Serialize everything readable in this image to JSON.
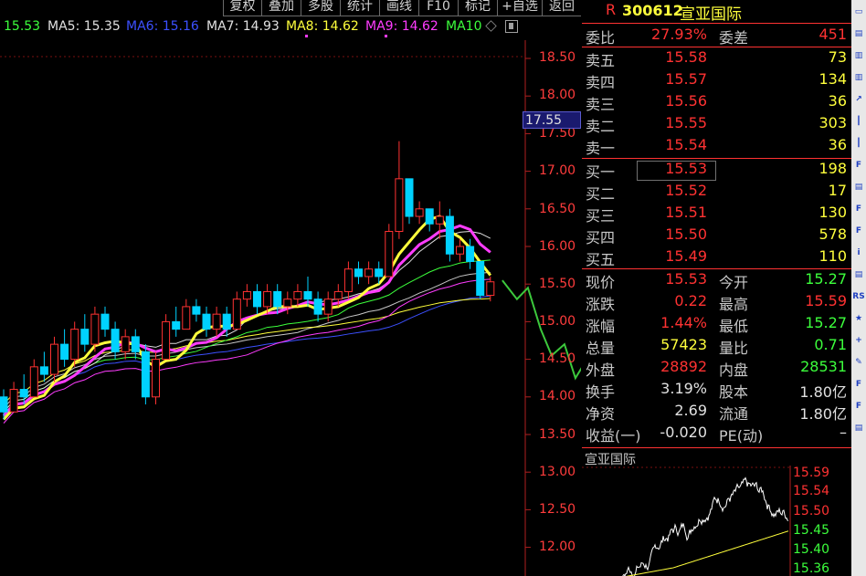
{
  "toolbar": {
    "items": [
      "复权",
      "叠加",
      "多股",
      "统计",
      "画线",
      "F10",
      "标记",
      "+自选",
      "返回"
    ]
  },
  "ma_legend": {
    "price": "15.53",
    "items": [
      {
        "label": "MA5: 15.35",
        "color": "#e0e0e0"
      },
      {
        "label": "MA6: 15.16",
        "color": "#3c50ff"
      },
      {
        "label": "MA7: 14.93",
        "color": "#e0e0e0"
      },
      {
        "label": "MA8: 14.62",
        "color": "#ffff3c"
      },
      {
        "label": "MA9: 14.62",
        "color": "#ff3cff"
      },
      {
        "label": "MA10",
        "color": "#3cff3c"
      }
    ]
  },
  "chart": {
    "axis_labels": [
      "18.50",
      "18.00",
      "17.50",
      "17.00",
      "16.50",
      "16.00",
      "15.50",
      "15.00",
      "14.50",
      "14.00",
      "13.50",
      "13.00",
      "12.50",
      "12.00"
    ],
    "crosshair_value": "17.55",
    "candles": [
      [
        14.0,
        14.1,
        13.7,
        13.8
      ],
      [
        13.8,
        14.2,
        13.8,
        14.1
      ],
      [
        14.1,
        14.3,
        13.9,
        14.0
      ],
      [
        14.0,
        14.5,
        14.0,
        14.4
      ],
      [
        14.4,
        14.6,
        14.2,
        14.3
      ],
      [
        14.3,
        14.8,
        14.2,
        14.7
      ],
      [
        14.7,
        14.9,
        14.4,
        14.5
      ],
      [
        14.5,
        15.0,
        14.4,
        14.9
      ],
      [
        14.9,
        15.1,
        14.6,
        14.7
      ],
      [
        14.7,
        15.2,
        14.6,
        15.1
      ],
      [
        15.1,
        15.2,
        14.8,
        14.9
      ],
      [
        14.9,
        15.0,
        14.5,
        14.6
      ],
      [
        14.6,
        14.9,
        14.5,
        14.8
      ],
      [
        14.8,
        14.9,
        14.5,
        14.6
      ],
      [
        14.6,
        14.7,
        13.9,
        14.0
      ],
      [
        14.0,
        14.6,
        13.9,
        14.5
      ],
      [
        14.5,
        15.1,
        14.5,
        15.0
      ],
      [
        15.0,
        15.2,
        14.8,
        14.9
      ],
      [
        14.9,
        15.3,
        14.9,
        15.2
      ],
      [
        15.2,
        15.3,
        15.0,
        15.1
      ],
      [
        15.1,
        15.2,
        14.8,
        14.9
      ],
      [
        14.9,
        15.2,
        14.8,
        15.1
      ],
      [
        15.1,
        15.2,
        14.8,
        14.9
      ],
      [
        14.9,
        15.4,
        14.9,
        15.3
      ],
      [
        15.3,
        15.5,
        15.2,
        15.4
      ],
      [
        15.4,
        15.5,
        15.1,
        15.2
      ],
      [
        15.2,
        15.5,
        15.1,
        15.4
      ],
      [
        15.4,
        15.5,
        15.1,
        15.2
      ],
      [
        15.2,
        15.4,
        15.1,
        15.3
      ],
      [
        15.3,
        15.5,
        15.2,
        15.4
      ],
      [
        15.4,
        15.6,
        15.2,
        15.3
      ],
      [
        15.3,
        15.4,
        15.0,
        15.1
      ],
      [
        15.1,
        15.4,
        15.0,
        15.3
      ],
      [
        15.3,
        15.5,
        15.2,
        15.4
      ],
      [
        15.4,
        15.8,
        15.3,
        15.7
      ],
      [
        15.7,
        15.8,
        15.5,
        15.6
      ],
      [
        15.6,
        15.8,
        15.5,
        15.7
      ],
      [
        15.7,
        15.8,
        15.5,
        15.6
      ],
      [
        15.6,
        16.3,
        15.6,
        16.2
      ],
      [
        16.2,
        17.4,
        16.1,
        16.9
      ],
      [
        16.9,
        16.9,
        16.3,
        16.4
      ],
      [
        16.4,
        16.6,
        16.3,
        16.5
      ],
      [
        16.5,
        16.5,
        16.2,
        16.3
      ],
      [
        16.3,
        16.6,
        16.1,
        16.4
      ],
      [
        16.4,
        16.5,
        15.8,
        15.9
      ],
      [
        15.9,
        16.1,
        15.8,
        16.0
      ],
      [
        16.0,
        16.1,
        15.7,
        15.8
      ],
      [
        15.8,
        15.8,
        15.3,
        15.35
      ],
      [
        15.35,
        15.6,
        15.27,
        15.53
      ]
    ]
  },
  "quote": {
    "code": "300612",
    "name": "宣亚国际",
    "webi": {
      "label": "委比",
      "value": "27.93%",
      "label2": "委差",
      "value2": "451"
    },
    "asks": [
      {
        "label": "卖五",
        "price": "15.58",
        "vol": "73"
      },
      {
        "label": "卖四",
        "price": "15.57",
        "vol": "134"
      },
      {
        "label": "卖三",
        "price": "15.56",
        "vol": "36"
      },
      {
        "label": "卖二",
        "price": "15.55",
        "vol": "303"
      },
      {
        "label": "卖一",
        "price": "15.54",
        "vol": "36"
      }
    ],
    "bids": [
      {
        "label": "买一",
        "price": "15.53",
        "vol": "198"
      },
      {
        "label": "买二",
        "price": "15.52",
        "vol": "17"
      },
      {
        "label": "买三",
        "price": "15.51",
        "vol": "130"
      },
      {
        "label": "买四",
        "price": "15.50",
        "vol": "578"
      },
      {
        "label": "买五",
        "price": "15.49",
        "vol": "110"
      }
    ],
    "stats": [
      {
        "l1": "现价",
        "v1": "15.53",
        "c1": "red",
        "l2": "今开",
        "v2": "15.27",
        "c2": "green"
      },
      {
        "l1": "涨跌",
        "v1": "0.22",
        "c1": "red",
        "l2": "最高",
        "v2": "15.59",
        "c2": "red"
      },
      {
        "l1": "涨幅",
        "v1": "1.44%",
        "c1": "red",
        "l2": "最低",
        "v2": "15.27",
        "c2": "green"
      },
      {
        "l1": "总量",
        "v1": "57423",
        "c1": "yellow",
        "l2": "量比",
        "v2": "0.71",
        "c2": "green"
      },
      {
        "l1": "外盘",
        "v1": "28892",
        "c1": "red",
        "l2": "内盘",
        "v2": "28531",
        "c2": "green"
      },
      {
        "l1": "换手",
        "v1": "3.19%",
        "c1": "white",
        "l2": "股本",
        "v2": "1.80亿",
        "c2": "white"
      },
      {
        "l1": "净资",
        "v1": "2.69",
        "c1": "white",
        "l2": "流通",
        "v2": "1.80亿",
        "c2": "white"
      },
      {
        "l1": "收益(一)",
        "v1": "-0.020",
        "c1": "white",
        "l2": "PE(动)",
        "v2": "–",
        "c2": "white"
      }
    ]
  },
  "mini": {
    "title": "宣亚国际",
    "axis_labels": [
      "15.59",
      "15.54",
      "15.50",
      "15.45",
      "15.40",
      "15.36"
    ]
  },
  "icons": [
    "document-icon",
    "chart-icon",
    "bar-chart-icon",
    "bar-chart-icon",
    "line-chart-icon",
    "candle-chart-icon",
    "candle-chart-icon",
    "f10-icon",
    "chart-icon",
    "f10-icon",
    "f10-icon",
    "info-icon",
    "chart-icon",
    "rss-icon",
    "star-icon",
    "plus-icon",
    "pencil-icon",
    "f10-icon",
    "f10-icon",
    "chart-icon"
  ],
  "colors": {
    "up": "#ff3232",
    "down": "#00d2ff",
    "ma5": "#e0e0e0",
    "ma_yellow": "#ffff3c",
    "ma_magenta": "#ff3cff",
    "ma_green": "#3cff3c",
    "ma_blue": "#3c50ff"
  }
}
